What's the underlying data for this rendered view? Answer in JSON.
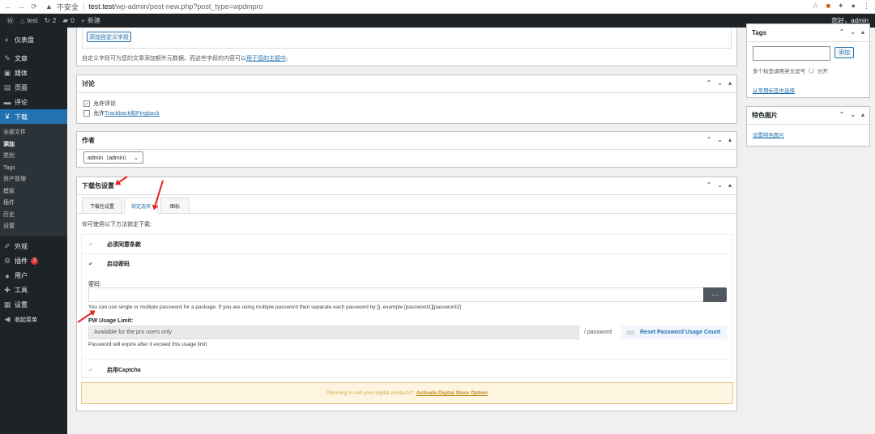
{
  "browser": {
    "security": "不安全",
    "host": "test.test",
    "path": "/wp-admin/post-new.php?post_type=wpdmpro"
  },
  "adminbar": {
    "site": "test",
    "updates": "2",
    "comments": "0",
    "new": "新建",
    "howdy": "您好，admin"
  },
  "sidebar": {
    "items": [
      {
        "label": "仪表盘",
        "icon": "dashboard-icon"
      },
      {
        "label": "文章",
        "icon": "pin-icon"
      },
      {
        "label": "媒体",
        "icon": "media-icon"
      },
      {
        "label": "页面",
        "icon": "page-icon"
      },
      {
        "label": "评论",
        "icon": "comment-icon"
      },
      {
        "label": "下载",
        "icon": "download-icon"
      }
    ],
    "submenu": [
      "全部文件",
      "添加",
      "类别",
      "Tags",
      "资产管理",
      "模板",
      "插件",
      "历史",
      "设置"
    ],
    "items2": [
      {
        "label": "外观",
        "icon": "brush-icon"
      },
      {
        "label": "插件",
        "icon": "plugin-icon",
        "badge": "2"
      },
      {
        "label": "用户",
        "icon": "user-icon"
      },
      {
        "label": "工具",
        "icon": "wrench-icon"
      },
      {
        "label": "设置",
        "icon": "settings-icon"
      },
      {
        "label": "收起菜单",
        "icon": "collapse-icon"
      }
    ]
  },
  "custom_fields": {
    "button": "添加自定义字段",
    "note_prefix": "自定义字段可为您的文章添加额外元数据。而这些字段的内容可以",
    "note_link": "用于您的主题中",
    "note_suffix": "。"
  },
  "discussion": {
    "title": "讨论",
    "allow_comments": "允许评论",
    "allow_prefix": "允许",
    "trackback_link": "Trackback和Pingback"
  },
  "author": {
    "title": "作者",
    "value": "admin（admin）"
  },
  "package": {
    "title": "下载包设置",
    "tabs": [
      "下载包设置",
      "锁定选项",
      "图标"
    ],
    "intro": "你可使用以下方法锁定下载:",
    "terms_label": "必须同意条款",
    "password_label": "启动密码",
    "password_field_label": "密码:",
    "generate_button": "···",
    "password_help": "You can use single or multiple password for a package. If you are using multiple password then separate each password by [], example [password1][password2]",
    "pw_limit_label": "PW Usage Limit:",
    "pw_limit_value": "Available for the pro users only",
    "per_password": "/ password",
    "reset_label": "Reset Password Usage Count",
    "expire_note": "Password will expire after it exceed this usage limit",
    "captcha_label": "启用Captcha",
    "promo_text": "Planning to sell your digital products?",
    "promo_link": "Activate Digital Store Option"
  },
  "tags_box": {
    "title": "Tags",
    "add_button": "添加",
    "hint": "多个标签请用英文逗号（,）分开",
    "choose_link": "从常用标签中选择"
  },
  "featured": {
    "title": "特色图片",
    "link": "设置特色图片"
  },
  "colors": {
    "accent": "#2271b1",
    "sidebar_bg": "#1d2327",
    "annotation": "#e32323",
    "promo_bg": "#fdf5e0"
  }
}
